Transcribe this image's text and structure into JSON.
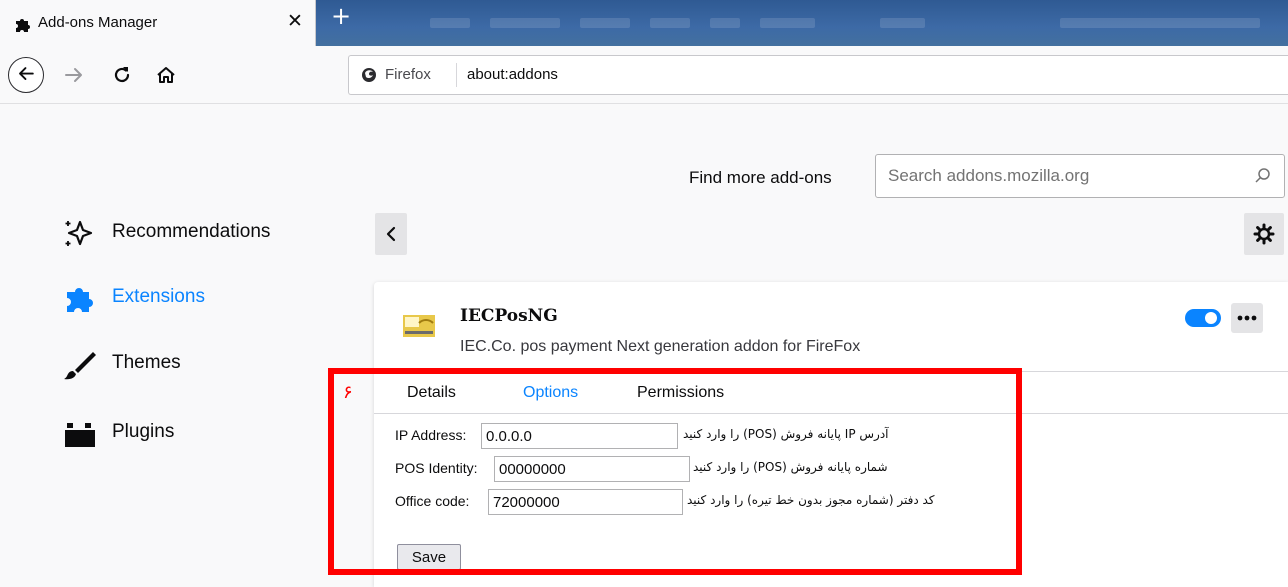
{
  "browser": {
    "tab_title": "Add-ons Manager",
    "close_glyph": "✕",
    "new_tab_glyph": "+",
    "identity_label": "Firefox",
    "url": "about:addons"
  },
  "header": {
    "find_more_label": "Find more add-ons",
    "search_placeholder": "Search addons.mozilla.org"
  },
  "sidebar": {
    "items": [
      {
        "label": "Recommendations",
        "icon": "recommendations-icon",
        "selected": false
      },
      {
        "label": "Extensions",
        "icon": "puzzle-icon",
        "selected": true
      },
      {
        "label": "Themes",
        "icon": "brush-icon",
        "selected": false
      },
      {
        "label": "Plugins",
        "icon": "plugin-icon",
        "selected": false
      }
    ]
  },
  "addon": {
    "name": "IECPosNG",
    "description": "IEC.Co. pos payment Next generation addon for FireFox",
    "enabled": true,
    "more_glyph": "•••",
    "tabs": [
      {
        "label": "Details",
        "active": false
      },
      {
        "label": "Options",
        "active": true
      },
      {
        "label": "Permissions",
        "active": false
      }
    ],
    "options": {
      "fields": [
        {
          "label": "IP Address:",
          "value": "0.0.0.0",
          "hint": "آدرس IP پایانه فروش (POS) را وارد کنید"
        },
        {
          "label": "POS Identity:",
          "value": "00000000",
          "hint": "شماره پایانه فروش (POS) را وارد کنید"
        },
        {
          "label": "Office code:",
          "value": "72000000",
          "hint": "کد دفتر (شماره مجوز بدون خط تیره) را وارد کنید"
        }
      ],
      "save_label": "Save"
    }
  },
  "annotation": {
    "number": "۶",
    "color": "#ff0000"
  },
  "colors": {
    "accent": "#0a84ff",
    "tabbar": "#3d6aa6"
  }
}
